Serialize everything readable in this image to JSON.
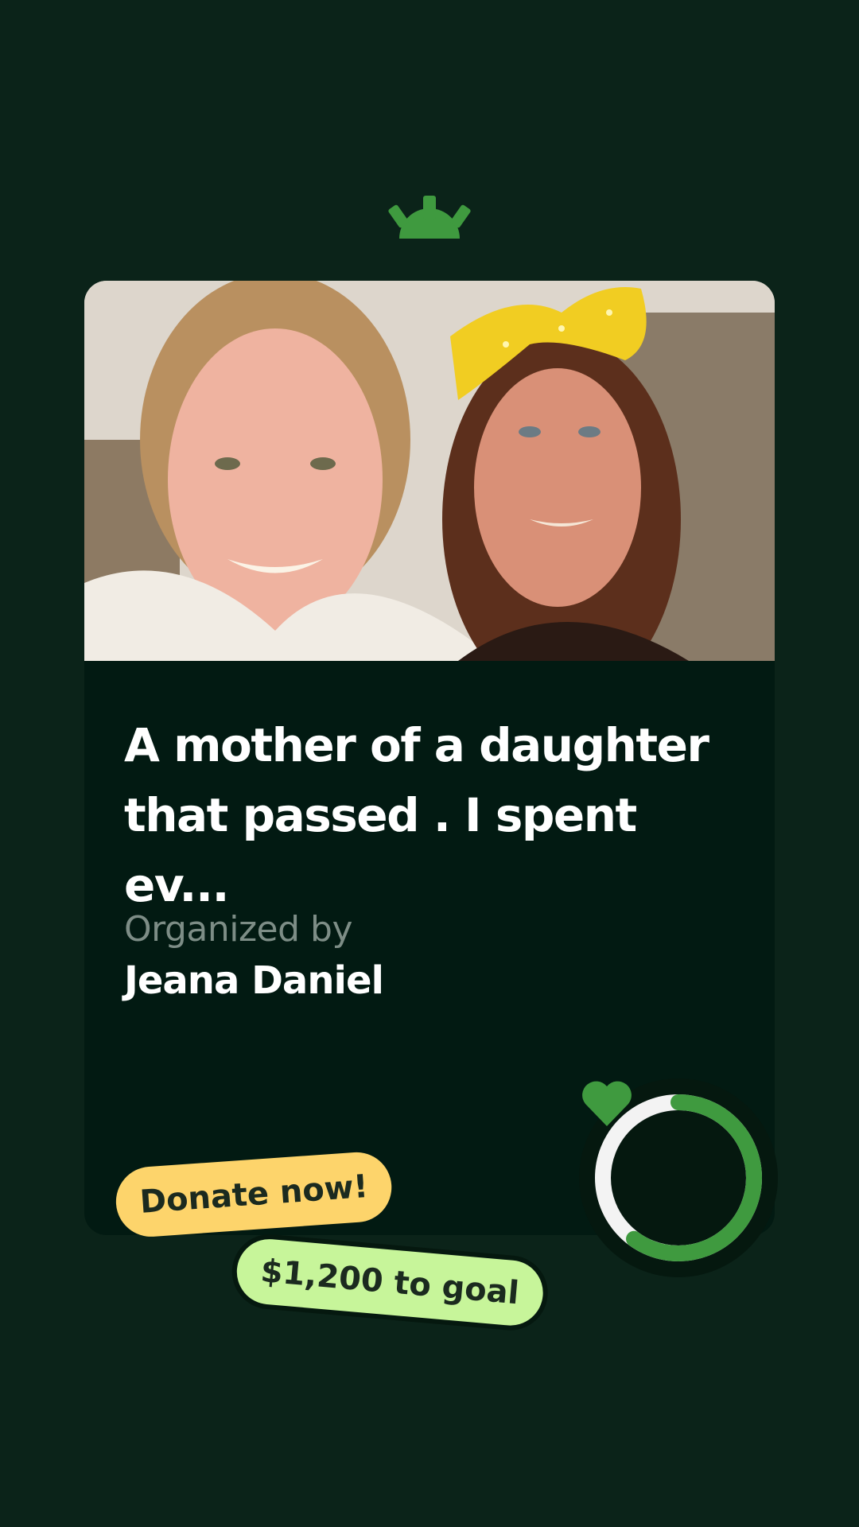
{
  "card": {
    "title": "A mother of a daughter that passed . I spent ev...",
    "organizer_label": "Organized by",
    "organizer_name": "Jeana Daniel"
  },
  "cta": {
    "donate_label": "Donate now!",
    "goal_label": "$1,200 to goal"
  },
  "progress": {
    "fraction_raised": 0.6
  },
  "icons": {
    "logo": "sunrise-logo-icon",
    "progress_center": "heart-icon"
  },
  "colors": {
    "background": "#0b2319",
    "card": "#021a12",
    "accent_green": "#3f9a3f",
    "donate_pill": "#fdd46b",
    "goal_pill": "#c7f59a",
    "ring_track": "#f3f3f3"
  }
}
